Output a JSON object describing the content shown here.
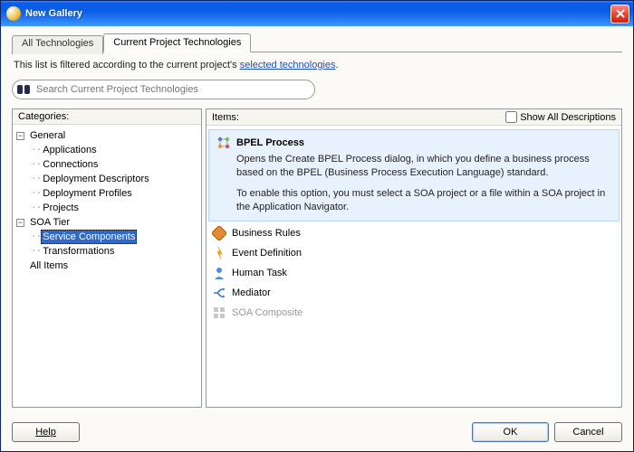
{
  "window": {
    "title": "New Gallery"
  },
  "tabs": {
    "all": "All Technologies",
    "current": "Current Project Technologies"
  },
  "info": {
    "prefix": "This list is filtered according to the current project's ",
    "link": "selected technologies",
    "suffix": "."
  },
  "search": {
    "placeholder": "Search Current Project Technologies"
  },
  "categories": {
    "header": "Categories:",
    "nodes": {
      "general": "General",
      "applications": "Applications",
      "connections": "Connections",
      "deploy_desc": "Deployment Descriptors",
      "deploy_prof": "Deployment Profiles",
      "projects": "Projects",
      "soa_tier": "SOA Tier",
      "service_components": "Service Components",
      "transformations": "Transformations",
      "all_items": "All Items"
    }
  },
  "items": {
    "header": "Items:",
    "show_all": "Show All Descriptions",
    "bpel": {
      "title": "BPEL Process",
      "desc1": "Opens the Create BPEL Process dialog, in which you define a business process based on the BPEL (Business Process Execution Language) standard.",
      "desc2": "To enable this option, you must select a SOA project or a file within a SOA project in the Application Navigator."
    },
    "business_rules": "Business Rules",
    "event_def": "Event Definition",
    "human_task": "Human Task",
    "mediator": "Mediator",
    "soa_composite": "SOA Composite"
  },
  "buttons": {
    "help": "Help",
    "ok": "OK",
    "cancel": "Cancel"
  }
}
